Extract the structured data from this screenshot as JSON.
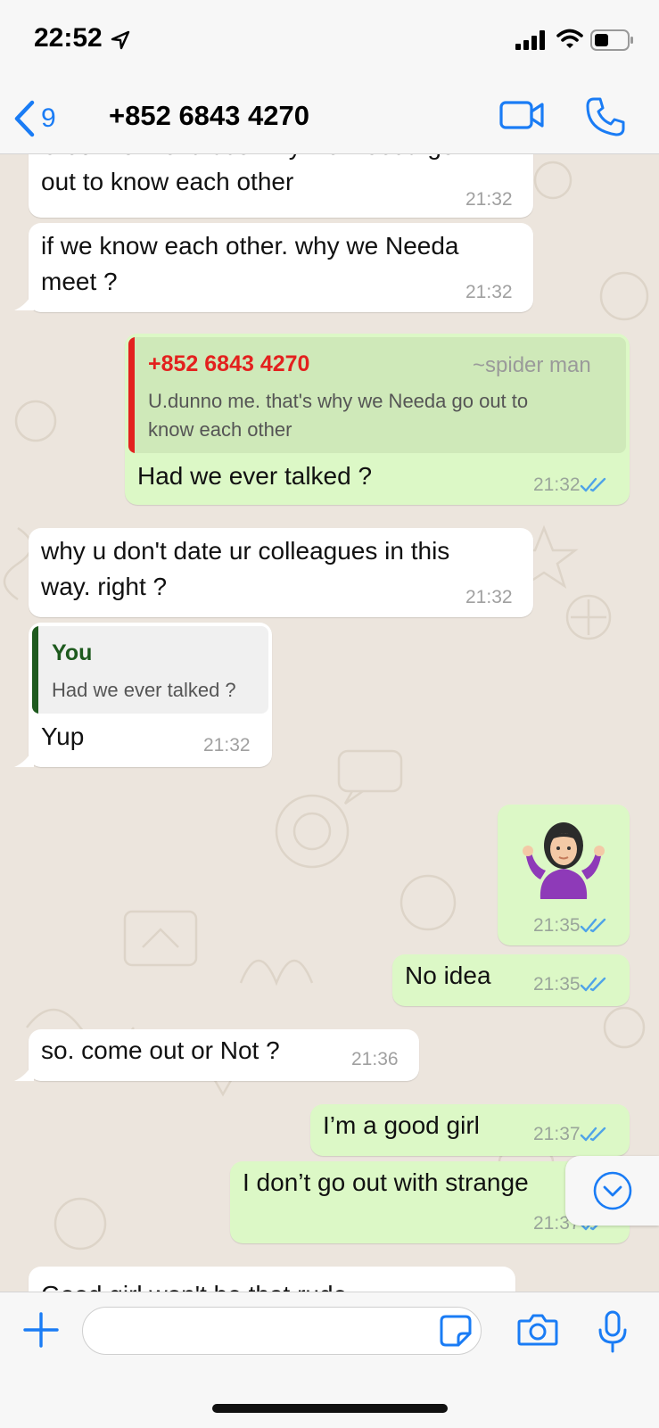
{
  "status_bar": {
    "time": "22:52"
  },
  "nav": {
    "back_count": "9",
    "contact": "+852 6843 4270"
  },
  "colors": {
    "accent": "#1a7cf5",
    "incoming": "#ffffff",
    "outgoing": "#dcf8c6",
    "read_ticks": "#4fa3e8",
    "quote_red": "#e3211e",
    "quote_green": "#1e5a1e"
  },
  "messages": [
    {
      "dir": "in",
      "text1": "U.dunno me. that's why we Needa go",
      "text2": "out to know each other",
      "time": "21:32"
    },
    {
      "dir": "in",
      "text1": "if we know each other. why we Needa",
      "text2": "meet ?",
      "time": "21:32"
    },
    {
      "dir": "out",
      "quote_sender": "+852 6843 4270",
      "quote_alias": "~spider man",
      "quote_line1": "U.dunno me. that's why we Needa go out to",
      "quote_line2": "know each other",
      "text": "Had we ever talked ?",
      "time": "21:32"
    },
    {
      "dir": "in",
      "text1": "why u don't date ur colleagues in this",
      "text2": "way. right ?",
      "time": "21:32"
    },
    {
      "dir": "in",
      "quote_sender": "You",
      "quote_text": "Had we ever talked ?",
      "text": "Yup",
      "time": "21:32"
    },
    {
      "dir": "out",
      "emoji": "🤷‍♀️",
      "time": "21:35"
    },
    {
      "dir": "out",
      "text": "No idea",
      "time": "21:35"
    },
    {
      "dir": "in",
      "text": "so. come out or Not ?",
      "time": "21:36"
    },
    {
      "dir": "out",
      "text": "I’m a good girl",
      "time": "21:37"
    },
    {
      "dir": "out",
      "text": "I don’t go out with strange",
      "time": "21:37"
    },
    {
      "dir": "in",
      "text": "Good girl won't be that rude"
    }
  ],
  "icons": {
    "back": "chevron-left-icon",
    "video": "video-call-icon",
    "phone": "phone-icon",
    "plus": "plus-icon",
    "sticker": "sticker-icon",
    "camera": "camera-icon",
    "mic": "microphone-icon",
    "scroll": "chevron-down-circle-icon"
  }
}
